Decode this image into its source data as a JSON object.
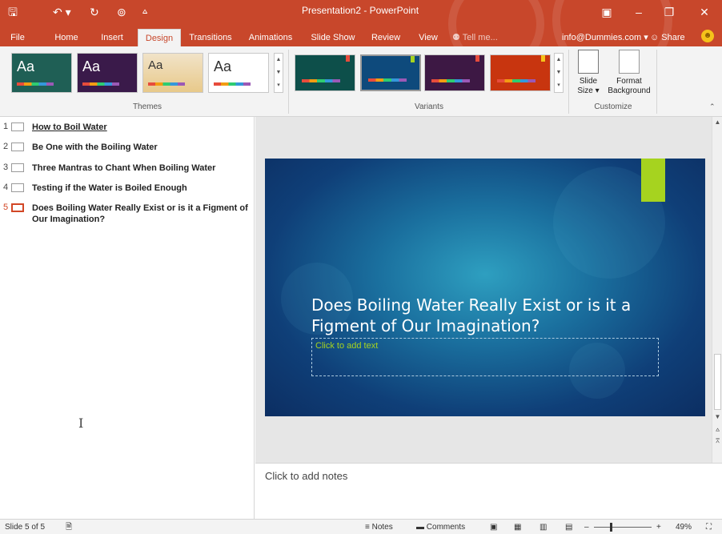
{
  "window": {
    "title": "Presentation2 - PowerPoint",
    "qat_icons": [
      "save-icon",
      "undo-icon",
      "repeat-icon",
      "start-from-beginning-icon",
      "customize-qat-icon"
    ]
  },
  "tabs": [
    {
      "label": "File"
    },
    {
      "label": "Home"
    },
    {
      "label": "Insert"
    },
    {
      "label": "Design"
    },
    {
      "label": "Transitions"
    },
    {
      "label": "Animations"
    },
    {
      "label": "Slide Show"
    },
    {
      "label": "Review"
    },
    {
      "label": "View"
    }
  ],
  "active_tab": "Design",
  "tell_me": "Tell me...",
  "account": "info@Dummies.com",
  "share": "Share",
  "ribbon": {
    "themes_label": "Themes",
    "theme_aa": [
      "Aa",
      "Aa",
      "Aa",
      "Aa"
    ],
    "variants_label": "Variants",
    "slide_size_label": "Slide",
    "slide_size_label2": "Size",
    "format_bg_label": "Format",
    "format_bg_label2": "Background",
    "customize_label": "Customize"
  },
  "outline": [
    {
      "num": "1",
      "text": "How to Boil Water"
    },
    {
      "num": "2",
      "text": "Be One with the Boiling Water"
    },
    {
      "num": "3",
      "text": "Three Mantras to Chant When Boiling Water"
    },
    {
      "num": "4",
      "text": "Testing if the Water is Boiled Enough"
    },
    {
      "num": "5",
      "text": "Does Boiling Water Really Exist or is it a Figment of Our Imagination?"
    }
  ],
  "slide": {
    "title": "Does Boiling Water Really Exist or is it a Figment of Our Imagination?",
    "subtitle_placeholder": "Click to add text",
    "accent_color": "#a6d31f"
  },
  "notes_placeholder": "Click to add notes",
  "status": {
    "slide_info": "Slide 5 of 5",
    "notes": "Notes",
    "comments": "Comments",
    "zoom": "49%"
  },
  "colors": {
    "brand": "#c8472b",
    "ribbon_bg": "#f3f3f3"
  }
}
